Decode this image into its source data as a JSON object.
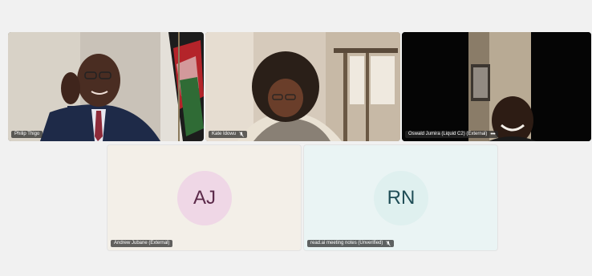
{
  "participants": [
    {
      "name": "Philip Thigo",
      "type": "video",
      "muted": false
    },
    {
      "name": "Kate Idowu",
      "type": "video",
      "muted": true
    },
    {
      "name": "Oswald Jumira (Liquid C2) (External)",
      "type": "video",
      "muted": false,
      "has_more_menu": true
    },
    {
      "name": "Andrew Jubane (External)",
      "type": "avatar",
      "initials": "AJ",
      "muted": false
    },
    {
      "name": "read.ai meeting notes (Unverified)",
      "type": "avatar",
      "initials": "RN",
      "muted": true
    }
  ],
  "colors": {
    "page_bg": "#f1f1f1",
    "aj_tile_bg": "#f3efe8",
    "aj_avatar_bg": "#efd7e6",
    "aj_initials": "#5c2a4a",
    "rn_tile_bg": "#eaf4f4",
    "rn_avatar_bg": "#dff0ef",
    "rn_initials": "#1f4d56",
    "name_tag_bg": "rgba(40,40,40,0.72)"
  },
  "icons": {
    "mic_muted": "mic-off-icon",
    "more": "more-options-icon"
  }
}
